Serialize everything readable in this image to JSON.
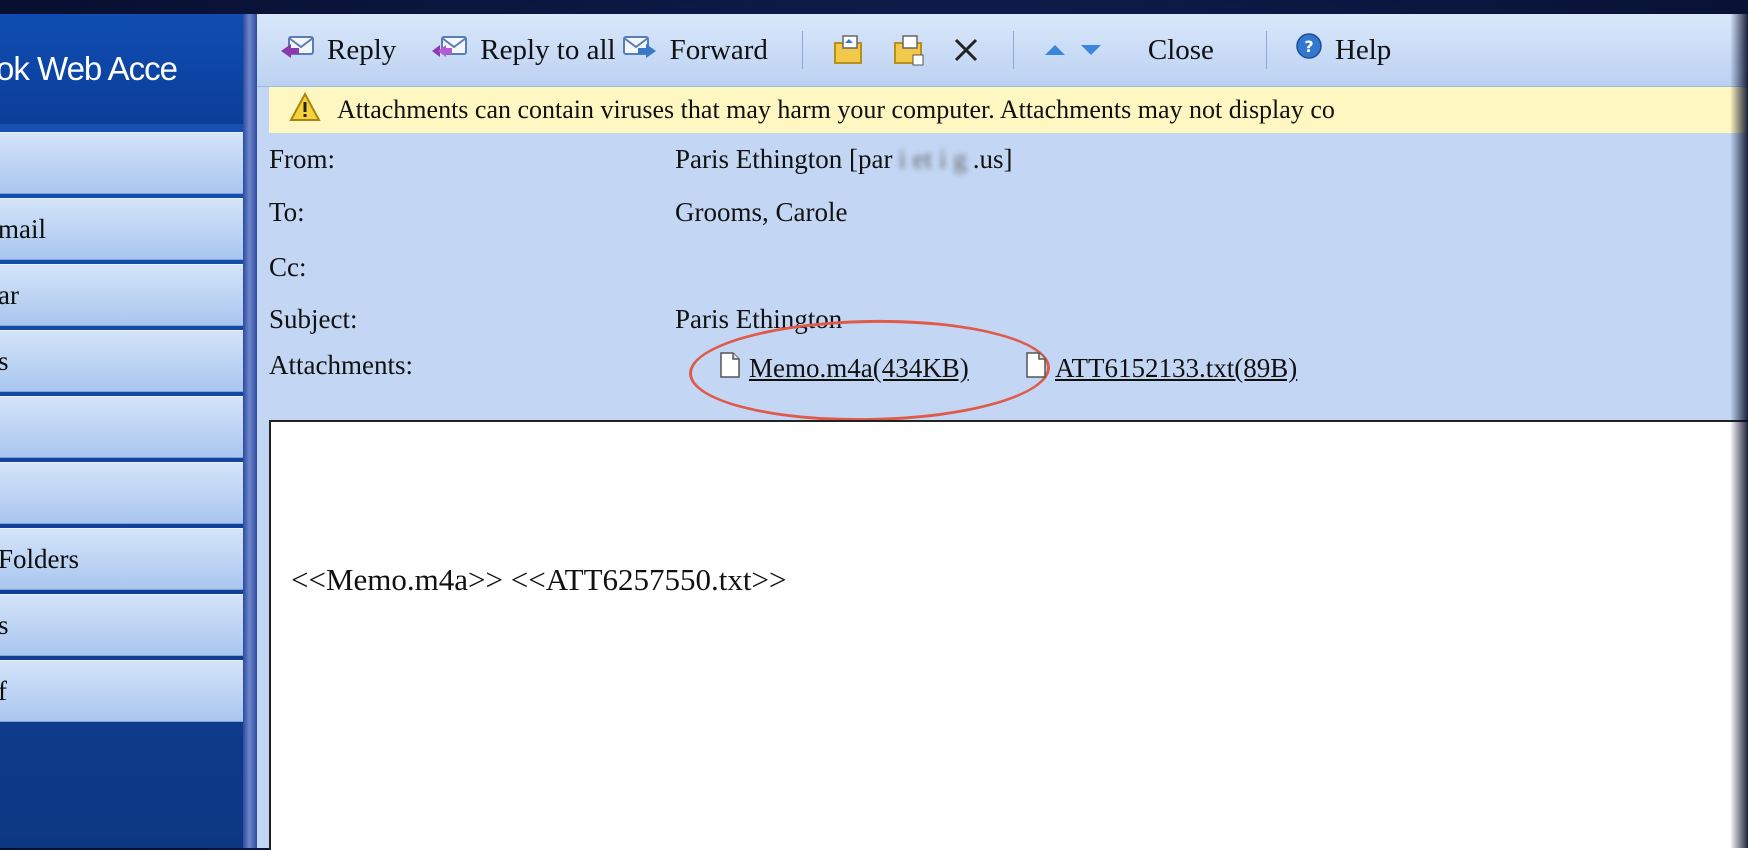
{
  "app": {
    "brand_title": "ok Web Acce"
  },
  "sidebar": {
    "items": [
      {
        "label": ""
      },
      {
        "label": "mail"
      },
      {
        "label": "ar"
      },
      {
        "label": "s"
      },
      {
        "label": ""
      },
      {
        "label": ""
      },
      {
        "label": "Folders"
      },
      {
        "label": "s"
      },
      {
        "label": "f"
      }
    ]
  },
  "toolbar": {
    "reply_label": "Reply",
    "reply_all_label": "Reply to all",
    "forward_label": "Forward",
    "close_label": "Close",
    "help_label": "Help"
  },
  "warning": {
    "text": "Attachments can contain viruses that may harm your computer. Attachments may not display co"
  },
  "message": {
    "from_label": "From:",
    "from_name": "Paris Ethington [par",
    "from_obscured": "i et i g",
    "from_suffix": ".us]",
    "to_label": "To:",
    "to_value": "Grooms, Carole",
    "cc_label": "Cc:",
    "cc_value": "",
    "subject_label": "Subject:",
    "subject_value": "Paris Ethington",
    "attachments_label": "Attachments:",
    "attachments": [
      {
        "name": "Memo.m4a(434KB)"
      },
      {
        "name": "ATT6152133.txt(89B)"
      }
    ],
    "body_text": "<<Memo.m4a>> <<ATT6257550.txt>>"
  },
  "colors": {
    "annotation_oval": "#e05a4a",
    "warning_bg": "#fff7c2",
    "header_bg": "#c3d7f4"
  }
}
